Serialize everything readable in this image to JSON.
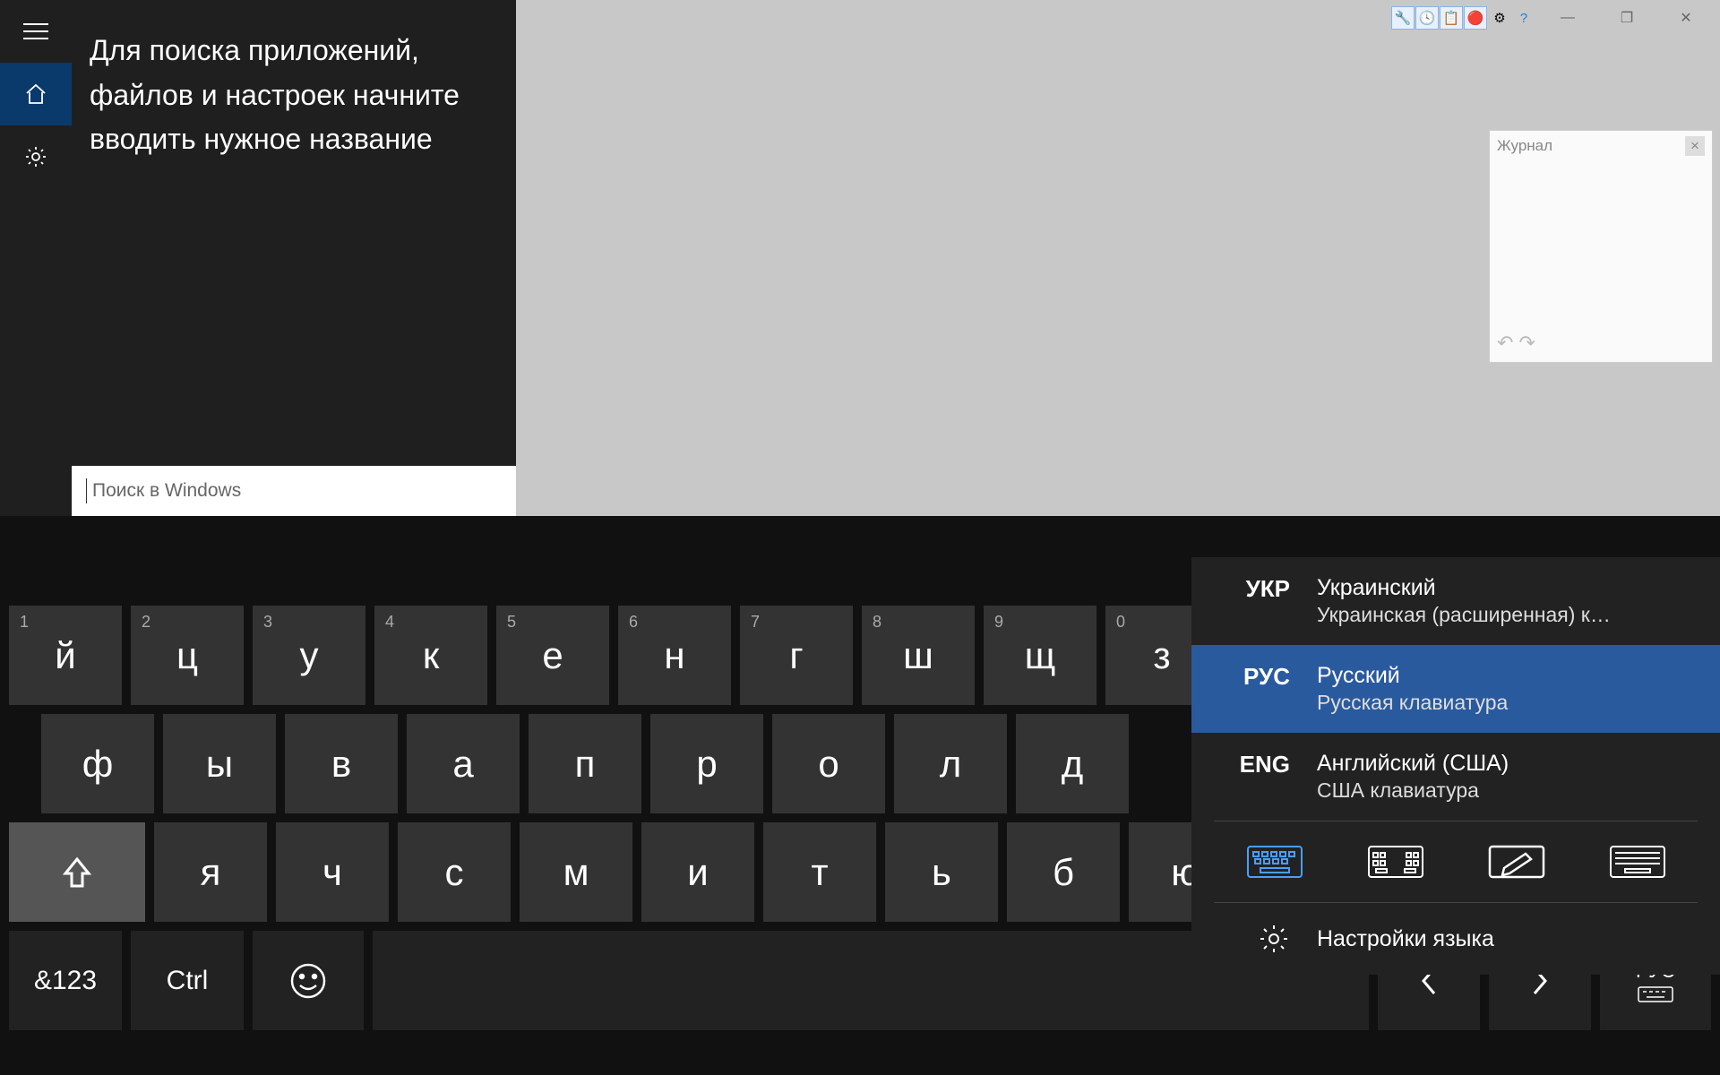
{
  "titlebar": {
    "minimize": "—",
    "maximize": "❐",
    "close": "✕"
  },
  "search": {
    "hint": "Для поиска приложений, файлов и настроек начните вводить нужное название",
    "placeholder": "Поиск в Windows"
  },
  "history": {
    "title": "Журнал"
  },
  "keyboard": {
    "row1": [
      {
        "n": "1",
        "k": "й"
      },
      {
        "n": "2",
        "k": "ц"
      },
      {
        "n": "3",
        "k": "у"
      },
      {
        "n": "4",
        "k": "к"
      },
      {
        "n": "5",
        "k": "е"
      },
      {
        "n": "6",
        "k": "н"
      },
      {
        "n": "7",
        "k": "г"
      },
      {
        "n": "8",
        "k": "ш"
      },
      {
        "n": "9",
        "k": "щ"
      },
      {
        "n": "0",
        "k": "з"
      }
    ],
    "row2": [
      "ф",
      "ы",
      "в",
      "а",
      "п",
      "р",
      "о",
      "л",
      "д"
    ],
    "row3": [
      "я",
      "ч",
      "с",
      "м",
      "и",
      "т",
      "ь",
      "б",
      "ю"
    ],
    "sym": "&123",
    "ctrl": "Ctrl",
    "lang_short": "РУС"
  },
  "languages": [
    {
      "code": "УКР",
      "name": "Украинский",
      "sub": "Украинская (расширенная) к…",
      "sel": false
    },
    {
      "code": "РУС",
      "name": "Русский",
      "sub": "Русская клавиатура",
      "sel": true
    },
    {
      "code": "ENG",
      "name": "Английский (США)",
      "sub": "США клавиатура",
      "sel": false
    }
  ],
  "lang_settings": "Настройки языка"
}
